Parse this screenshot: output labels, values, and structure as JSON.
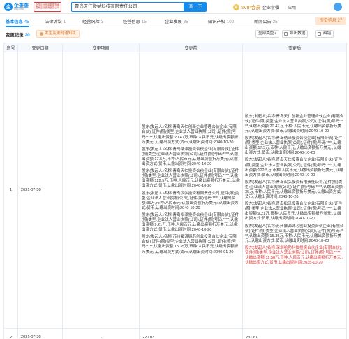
{
  "header": {
    "logo_mark": "企",
    "logo_name": "企查查",
    "logo_url": "Qcc.com",
    "badge_line1": "全国企业信用数据查询",
    "badge_line2": "国家企业信用信息公示",
    "search_value": "青岛天仁微纳科技有限责任公司",
    "search_button": "查一下",
    "vip_label": "SVIP会员",
    "nav_links": [
      "企业套餐",
      "应用"
    ]
  },
  "tabs": [
    {
      "label": "基本信息",
      "count": "45"
    },
    {
      "label": "法律诉讼",
      "count": "1"
    },
    {
      "label": "经营风险",
      "count": "3"
    },
    {
      "label": "经营信息",
      "count": "15"
    },
    {
      "label": "企业发展",
      "count": "35"
    },
    {
      "label": "知识产权",
      "count": "102"
    },
    {
      "label": "新闻公告",
      "count": "25"
    },
    {
      "label": "历史信息",
      "count": "27"
    }
  ],
  "section": {
    "title": "变更记录",
    "count": "20",
    "warn_chip": "发生变更时通知我",
    "filter_label": "全部类型",
    "btn_export": "导出数据",
    "btn_feedback": "纠错"
  },
  "table": {
    "headers": [
      "序号",
      "变更日期",
      "变更项目",
      "变更前",
      "变更后"
    ],
    "rows": [
      {
        "index": "1",
        "date": "2021-07-30",
        "item": "-",
        "before": [
          "股东(发起人)名称:青岛天仁创新企业管理合伙企业(有限合伙),证件(照)类型:企业法人营业执照(公司),证件(照)号码:****,认缴出资额:20.47万,币种:人民币元,认缴出资额折万美元:,认缴出资方式:货币,认缴出资时间:2040-10-20",
          "股东(发起人)名称:青岛纳泽投资合伙企业(有限合伙),证件(照)类型:企业法人营业执照(公司),证件(照)号码:****,认缴出资额:17.5万,币种:人民币元,认缴出资额折万美元:,认缴出资方式:货币,认缴出资时间:2040-10-20",
          "股东(发起人)名称:青岛天仁投资合伙企业(有限合伙),证件(照)类型:企业法人营业执照(公司),证件(照)号码:****,认缴出资额:122.5万,币种:人民币元,认缴出资额折万美元:,认缴出资方式:货币,认缴出资时间:2040-10-20",
          "股东(发起人)名称:青岛汉弘投资有限责任公司,证件(照)类型:企业法人营业执照(公司),证件(照)号码:****,认缴出资额:35万,币种:人民币元,认缴出资额折万美元:,认缴出资方式:货币,认缴出资时间:2040-10-20",
          "股东(发起人)名称:青岛松泽投资合伙企业(有限合伙),证件(照)类型:企业法人营业执照(公司),证件(照)号码:****,认缴出资额:9.21万,币种:人民币元,认缴出资额折万美元:,认缴出资方式:货币,认缴出资时间:2040-10-20",
          "股东(发起人)名称:苏州聚源铸芯创业投资合伙企业(有限合伙),证件(照)类型:企业法人营业执照(公司),证件(照)号码:****,认缴出资额:15.35万,币种:人民币元,认缴出资额折万美元:,认缴出资方式:货币,认缴出资时间:2040-01-20"
        ],
        "after": [
          "股东(发起人)名称:青岛天仁创新企业管理合伙企业(有限合伙),证件(照)类型:企业法人营业执照(公司),证件(照)号码:****,认缴出资额:20.47万,币种:人民币元,认缴出资额折万美元:,认缴出资方式:货币,认缴出资时间:2040-10-20",
          "股东(发起人)名称:青岛纳泽投资合伙企业(有限合伙),证件(照)类型:企业法人营业执照(公司),证件(照)号码:****,认缴出资额:17.5万,币种:人民币元,认缴出资额折万美元:,认缴出资方式:货币,认缴出资时间:2040-10-20",
          "股东(发起人)名称:青岛天仁投资合伙企业(有限合伙),证件(照)类型:企业法人营业执照(公司),证件(照)号码:****,认缴出资额:122.5万,币种:人民币元,认缴出资额折万美元:,认缴出资方式:货币,认缴出资时间:2040-10-20",
          "股东(发起人)名称:青岛汉弘投资有限责任公司,证件(照)类型:企业法人营业执照(公司),证件(照)号码:****,认缴出资额:35万,币种:人民币元,认缴出资额折万美元:,认缴出资方式:货币,认缴出资时间:2040-10-20",
          "股东(发起人)名称:青岛松泽投资合伙企业(有限合伙),证件(照)类型:企业法人营业执照(公司),证件(照)号码:****,认缴出资额:9.21万,币种:人民币元,认缴出资额折万美元:,认缴出资方式:货币,认缴出资时间:2040-10-20",
          "股东(发起人)名称:苏州聚源铸芯创业投资合伙企业(有限合伙),证件(照)类型:企业法人营业执照(公司),证件(照)号码:****,认缴出资额:15.35万,币种:人民币元,认缴出资额折万美元:,认缴出资方式:货币,认缴出资时间:2040-10-20"
        ],
        "after_new": "股东(发起人)名称:深圳哈勃科技投资合伙企业(有限合伙),证件(照)类型:企业法人营业执照(公司),证件(照)号码:****,认缴出资额:11.58万,币种:人民币元,认缴出资额折万美元:,认缴出资方式:货币,认缴出资时间:2035-10-20"
      },
      {
        "index": "2",
        "date": "2021-07-30",
        "item": "-",
        "before_value": "220.03",
        "after_value": "231.61"
      }
    ]
  }
}
